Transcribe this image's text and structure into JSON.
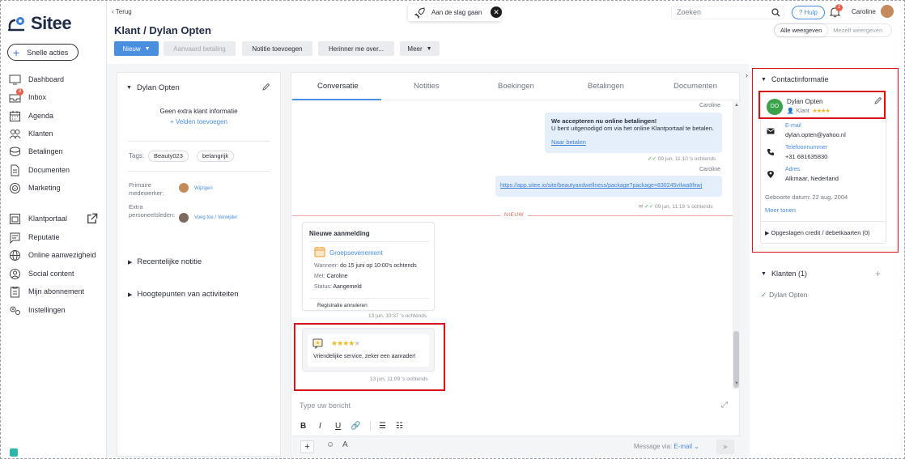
{
  "brand": {
    "name": "Sitee"
  },
  "sidebar": {
    "quick_actions": "Snelle acties",
    "items": [
      {
        "label": "Dashboard",
        "icon": "dashboard-icon"
      },
      {
        "label": "Inbox",
        "icon": "inbox-icon",
        "badge": "9"
      },
      {
        "label": "Agenda",
        "icon": "calendar-icon"
      },
      {
        "label": "Klanten",
        "icon": "users-icon"
      },
      {
        "label": "Betalingen",
        "icon": "payments-icon"
      },
      {
        "label": "Documenten",
        "icon": "document-icon"
      },
      {
        "label": "Marketing",
        "icon": "marketing-icon"
      },
      {
        "label": "Klantportaal",
        "icon": "portal-icon"
      },
      {
        "label": "Reputatie",
        "icon": "reputation-icon"
      },
      {
        "label": "Online aanwezigheid",
        "icon": "globe-icon"
      },
      {
        "label": "Social content",
        "icon": "social-icon"
      },
      {
        "label": "Mijn abonnement",
        "icon": "subscription-icon"
      },
      {
        "label": "Instellingen",
        "icon": "settings-icon"
      }
    ]
  },
  "topbar": {
    "back": "‹ Terug",
    "get_started": "Aan de slag gaan",
    "search_placeholder": "Zoeken",
    "help": "Hulp",
    "notif_count": "2",
    "user": "Caroline"
  },
  "page": {
    "title": "Klant / Dylan Opten",
    "views": {
      "all": "Alle weergeven",
      "mine": "Mezelf weergeven"
    },
    "toolbar": {
      "new": "Nieuw",
      "accept_payment": "Aanvaard betaling",
      "add_note": "Notitie toevoegen",
      "remind": "Herinner me over...",
      "more": "Meer"
    }
  },
  "client_panel": {
    "name": "Dylan Opten",
    "no_info": "Geen extra klant informatie",
    "add_fields": "+ Velden toevoegen",
    "tags_label": "Tags:",
    "tags": [
      "Beauty023",
      "belangrijk"
    ],
    "primary_label": "Primaire medewerker:",
    "primary_action": "Wijzigen",
    "extra_label": "Extra personeelsleden:",
    "extra_action": "Voeg toe / Verwijder",
    "recent_note": "Recentelijke notitie",
    "highlights": "Hoogtepunten van activiteiten"
  },
  "conversation": {
    "tabs": [
      "Conversatie",
      "Notities",
      "Boekingen",
      "Betalingen",
      "Documenten"
    ],
    "msg1": {
      "sender": "Caroline",
      "title": "We accepteren nu online betalingen!",
      "body": "U bent uitgenodigd om via het online Klantportaal te betalen.",
      "link": "Naar betalen",
      "time": "09 jun, 11:10 's ochtends"
    },
    "msg2": {
      "sender": "Caroline",
      "link": "https://app.sitee.io/site/beautyandwellness/package?package=830245vIlwa8fxwj",
      "time": "09 jun, 11:19 's ochtends"
    },
    "new_label": "NIEUW",
    "registration": {
      "heading": "Nieuwe aanmelding",
      "event": "Groepsevenement",
      "when_k": "Wanneer:",
      "when_v": "do 15 juni op 10:00's ochtends",
      "with_k": "Met:",
      "with_v": "Caroline",
      "status_k": "Status:",
      "status_v": "Aangemeld",
      "cancel": "Registratie annuleren",
      "time": "13 jun, 10:37 's ochtends"
    },
    "review": {
      "rating": 4,
      "text": "Vriendelijke service, zeker een aanrader!",
      "time": "13 jun, 11:09 's ochtends"
    },
    "composer": {
      "placeholder": "Type uw bericht",
      "via_label": "Message via:",
      "via_value": "E-mail"
    }
  },
  "contact": {
    "title": "Contactinformatie",
    "initials": "DO",
    "name": "Dylan Opten",
    "role": "Klant",
    "rating": 4,
    "email_label": "E-mail",
    "email": "dylan.opten@yahoo.nl",
    "phone_label": "Telefoonnummer",
    "phone": "+31 681635830",
    "address_label": "Adres",
    "address": "Alkmaar, Nederland",
    "birth": "Geboorte datum: 22 aug. 2004",
    "more": "Meer tonen",
    "saved_cards": "Opgeslagen credit / debetkaarten (0)"
  },
  "clients": {
    "title": "Klanten (1)",
    "items": [
      "Dylan Opten"
    ]
  },
  "colors": {
    "accent": "#4a8ee0",
    "highlight": "#d6151b",
    "new": "#e4624b",
    "star": "#f3b81a"
  }
}
